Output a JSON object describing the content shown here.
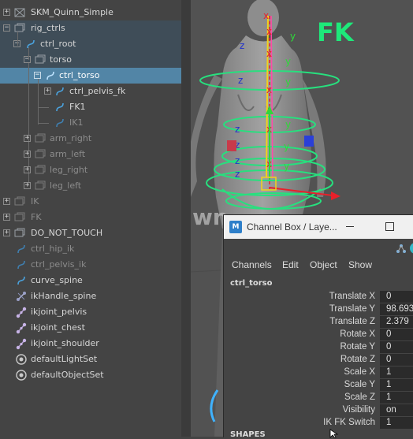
{
  "outliner": {
    "items": [
      {
        "label": "SKM_Quinn_Simple",
        "icon": "mesh-transform-icon",
        "dim": false
      },
      {
        "label": "rig_ctrls",
        "icon": "group-icon",
        "dim": false
      },
      {
        "label": "ctrl_root",
        "icon": "curve-icon",
        "dim": false
      },
      {
        "label": "torso",
        "icon": "group-icon",
        "dim": false
      },
      {
        "label": "ctrl_torso",
        "icon": "curve-icon",
        "dim": false
      },
      {
        "label": "ctrl_pelvis_fk",
        "icon": "curve-icon",
        "dim": false
      },
      {
        "label": "FK1",
        "icon": "curve-icon",
        "dim": false
      },
      {
        "label": "IK1",
        "icon": "curve-icon",
        "dim": true
      },
      {
        "label": "arm_right",
        "icon": "group-icon",
        "dim": true
      },
      {
        "label": "arm_left",
        "icon": "group-icon",
        "dim": true
      },
      {
        "label": "leg_right",
        "icon": "group-icon",
        "dim": true
      },
      {
        "label": "leg_left",
        "icon": "group-icon",
        "dim": true
      },
      {
        "label": "IK",
        "icon": "group-icon",
        "dim": true
      },
      {
        "label": "FK",
        "icon": "group-icon",
        "dim": true
      },
      {
        "label": "DO_NOT_TOUCH",
        "icon": "group-icon",
        "dim": false
      },
      {
        "label": "ctrl_hip_ik",
        "icon": "curve-icon",
        "dim": true
      },
      {
        "label": "ctrl_pelvis_ik",
        "icon": "curve-icon",
        "dim": true
      },
      {
        "label": "curve_spine",
        "icon": "curve-icon",
        "dim": false
      },
      {
        "label": "ikHandle_spine",
        "icon": "ik-handle-icon",
        "dim": false
      },
      {
        "label": "ikjoint_pelvis",
        "icon": "joint-icon",
        "dim": false
      },
      {
        "label": "ikjoint_chest",
        "icon": "joint-icon",
        "dim": false
      },
      {
        "label": "ikjoint_shoulder",
        "icon": "joint-icon",
        "dim": false
      },
      {
        "label": "defaultLightSet",
        "icon": "set-icon",
        "dim": false
      },
      {
        "label": "defaultObjectSet",
        "icon": "set-icon",
        "dim": false
      }
    ]
  },
  "viewport": {
    "overlay_label": "FK",
    "watermark": "@dawn",
    "colors": {
      "fk_text": "#1ee87a",
      "ctrl_curve": "#27e07e",
      "joint_yellow": "#f2d21a",
      "axis_x": "#e8202a",
      "axis_y": "#2fd83a",
      "axis_z": "#2233cc"
    }
  },
  "channel_box": {
    "title": "Channel Box / Laye...",
    "menu": [
      "Channels",
      "Edit",
      "Object",
      "Show"
    ],
    "object_name": "ctrl_torso",
    "attributes": [
      {
        "name": "Translate X",
        "value": "0"
      },
      {
        "name": "Translate Y",
        "value": "98.693"
      },
      {
        "name": "Translate Z",
        "value": "2.379"
      },
      {
        "name": "Rotate X",
        "value": "0"
      },
      {
        "name": "Rotate Y",
        "value": "0"
      },
      {
        "name": "Rotate Z",
        "value": "0"
      },
      {
        "name": "Scale X",
        "value": "1"
      },
      {
        "name": "Scale Y",
        "value": "1"
      },
      {
        "name": "Scale Z",
        "value": "1"
      },
      {
        "name": "Visibility",
        "value": "on"
      },
      {
        "name": "IK FK Switch",
        "value": "1"
      }
    ],
    "shapes_header": "SHAPES"
  }
}
